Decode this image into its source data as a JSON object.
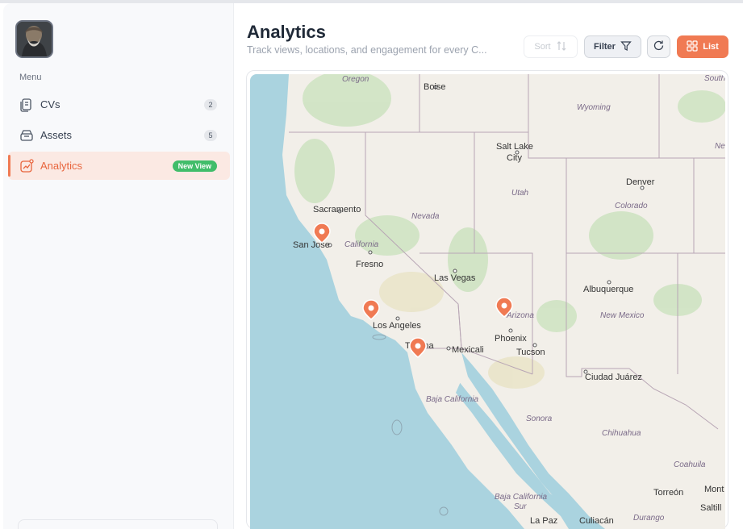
{
  "sidebar": {
    "menu_label": "Menu",
    "items": [
      {
        "label": "CVs",
        "badge": "2"
      },
      {
        "label": "Assets",
        "badge": "5"
      },
      {
        "label": "Analytics",
        "badge": "New View"
      }
    ]
  },
  "header": {
    "title": "Analytics",
    "subtitle": "Track views, locations, and engagement for every C..."
  },
  "toolbar": {
    "sort_label": "Sort",
    "filter_label": "Filter",
    "list_label": "List"
  },
  "map": {
    "labels": {
      "oregon": "Oregon",
      "boise": "Boise",
      "wyoming": "Wyoming",
      "south": "South",
      "ne": "Ne",
      "salt_lake": "Salt Lake",
      "city": "City",
      "utah": "Utah",
      "denver": "Denver",
      "colorado": "Colorado",
      "sacramento": "Sacramento",
      "nevada": "Nevada",
      "san_jose": "San Jose",
      "california": "California",
      "fresno": "Fresno",
      "las_vegas": "Las Vegas",
      "albuquerque": "Albuquerque",
      "new_mexico": "New Mexico",
      "arizona": "Arizona",
      "los_angeles": "Los Angeles",
      "phoenix": "Phoenix",
      "tijuana": "Tijuana",
      "mexicali": "Mexicali",
      "tucson": "Tucson",
      "ciudad_juarez": "Ciudad Juárez",
      "baja_california": "Baja California",
      "sonora": "Sonora",
      "chihuahua": "Chihuahua",
      "coahuila": "Coahuila",
      "torreon": "Torreón",
      "mont": "Mont",
      "saltill": "Saltill",
      "baja_california_sur": "Baja California",
      "sur": "Sur",
      "la_paz": "La Paz",
      "culiacan": "Culiacán",
      "durango": "Durango"
    }
  },
  "colors": {
    "accent": "#f07a53",
    "success": "#41bd6a",
    "water": "#aad3df",
    "land": "#f2efe9"
  }
}
